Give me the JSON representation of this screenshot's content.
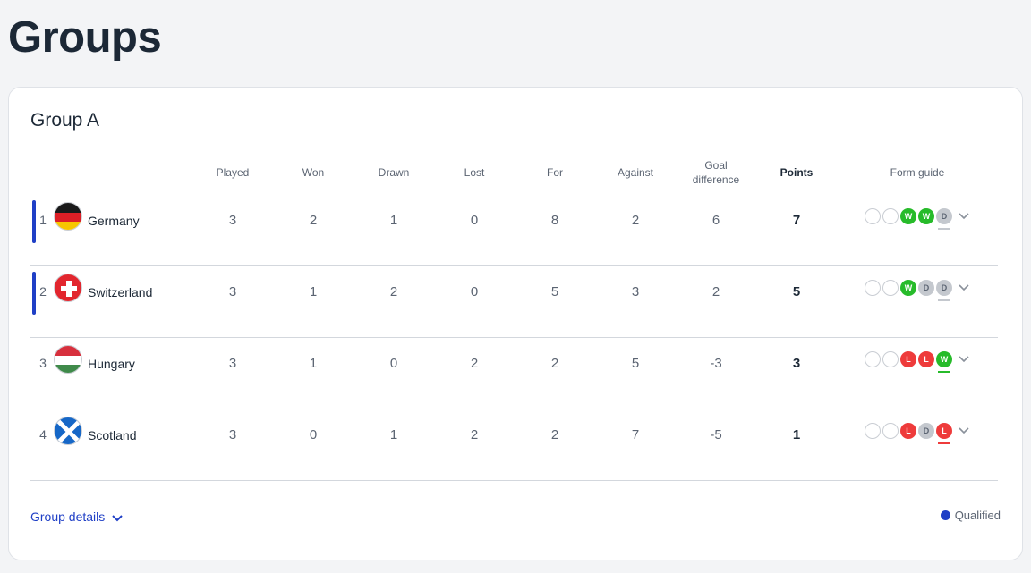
{
  "page": {
    "title": "Groups"
  },
  "group": {
    "title": "Group A",
    "headers": {
      "played": "Played",
      "won": "Won",
      "drawn": "Drawn",
      "lost": "Lost",
      "for": "For",
      "against": "Against",
      "goal_difference_line1": "Goal",
      "goal_difference_line2": "difference",
      "points": "Points",
      "form_guide": "Form guide"
    },
    "rows": [
      {
        "pos": "1",
        "team": "Germany",
        "flag": "germany-flag-icon",
        "qualified": true,
        "played": "3",
        "won": "2",
        "drawn": "1",
        "lost": "0",
        "for": "8",
        "against": "2",
        "gd": "6",
        "points": "7",
        "form": [
          "",
          "",
          "W",
          "W",
          "D"
        ]
      },
      {
        "pos": "2",
        "team": "Switzerland",
        "flag": "switzerland-flag-icon",
        "qualified": true,
        "played": "3",
        "won": "1",
        "drawn": "2",
        "lost": "0",
        "for": "5",
        "against": "3",
        "gd": "2",
        "points": "5",
        "form": [
          "",
          "",
          "W",
          "D",
          "D"
        ]
      },
      {
        "pos": "3",
        "team": "Hungary",
        "flag": "hungary-flag-icon",
        "qualified": false,
        "played": "3",
        "won": "1",
        "drawn": "0",
        "lost": "2",
        "for": "2",
        "against": "5",
        "gd": "-3",
        "points": "3",
        "form": [
          "",
          "",
          "L",
          "L",
          "W"
        ]
      },
      {
        "pos": "4",
        "team": "Scotland",
        "flag": "scotland-flag-icon",
        "qualified": false,
        "played": "3",
        "won": "0",
        "drawn": "1",
        "lost": "2",
        "for": "2",
        "against": "7",
        "gd": "-5",
        "points": "1",
        "form": [
          "",
          "",
          "L",
          "D",
          "L"
        ]
      }
    ],
    "details_label": "Group details",
    "legend_label": "Qualified"
  },
  "colors": {
    "qualified": "#1f3fc6",
    "win": "#27bb2a",
    "loss": "#ee3b3b",
    "draw": "#c4c8ce"
  }
}
